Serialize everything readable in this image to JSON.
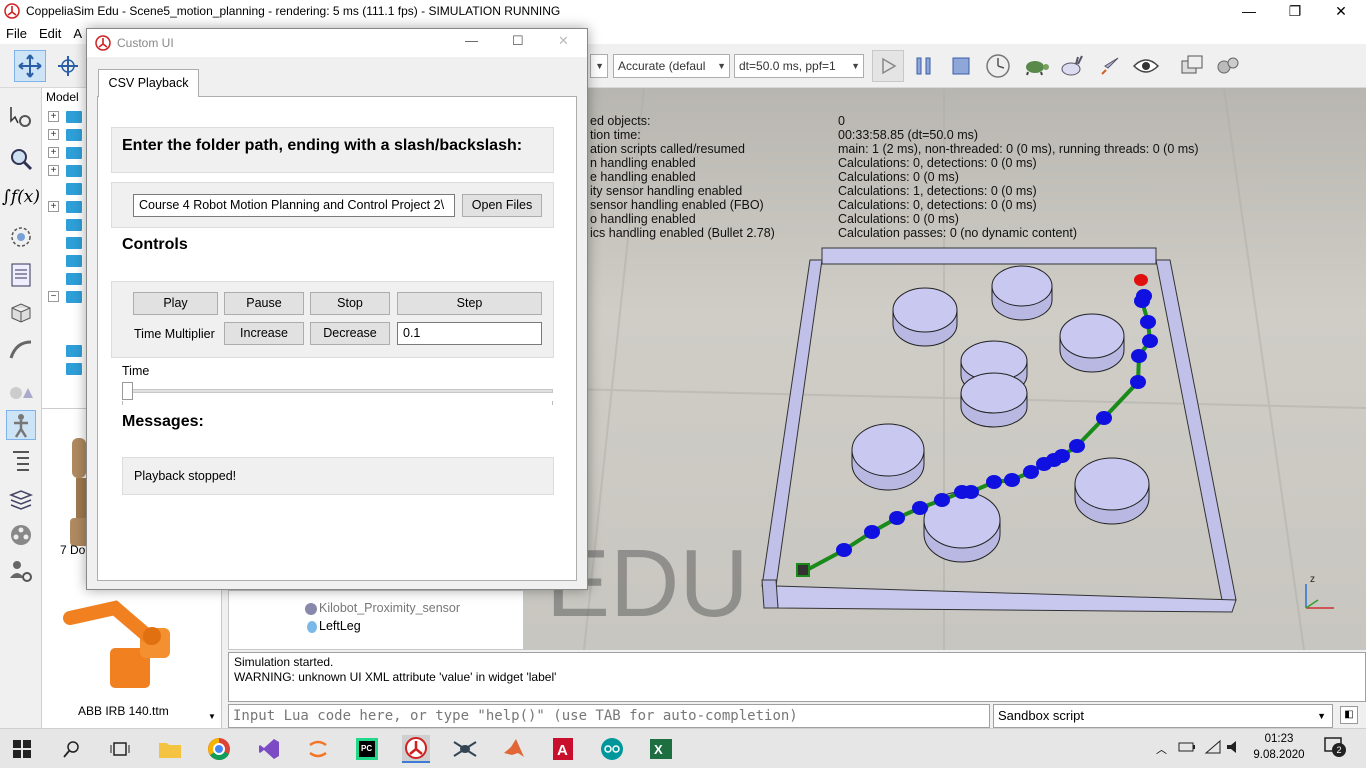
{
  "window": {
    "title": "CoppeliaSim Edu - Scene5_motion_planning - rendering: 5 ms (111.1 fps) - SIMULATION RUNNING"
  },
  "menu": {
    "items": [
      "File",
      "Edit",
      "A"
    ]
  },
  "toolbar": {
    "engine_combo": "Accurate (defaul",
    "dt_combo": "dt=50.0 ms, ppf=1"
  },
  "model_browser": {
    "header": "Model",
    "model_label_1": "7 Do",
    "model_label_2": "ABB IRB 140.ttm"
  },
  "scene_hierarchy": {
    "item_1": "Kilobot_Proximity_sensor",
    "item_2": "LeftLeg"
  },
  "viewport": {
    "info_left": [
      "ed objects:",
      "tion time:",
      "ation scripts called/resumed",
      "n handling enabled",
      "e handling enabled",
      "ity sensor handling enabled",
      "sensor handling enabled (FBO)",
      "o handling enabled",
      "ics handling enabled (Bullet 2.78)"
    ],
    "info_right": [
      "0",
      "00:33:58.85 (dt=50.0 ms)",
      "main: 1 (2 ms), non-threaded: 0 (0 ms), running threads: 0 (0 ms)",
      "Calculations: 0, detections: 0 (0 ms)",
      "Calculations: 0 (0 ms)",
      "Calculations: 1, detections: 0 (0 ms)",
      "Calculations: 0, detections: 0 (0 ms)",
      "Calculations: 0 (0 ms)",
      "Calculation passes: 0 (no dynamic content)"
    ],
    "watermark": "EDU",
    "axis_z": "z",
    "colors": {
      "path": "#1a8a1a",
      "waypoint": "#1010e0",
      "start": "#e01010",
      "obstacle": "#c8c8f0",
      "wall": "#c0c0e8"
    }
  },
  "console": {
    "lines": [
      "Simulation started.",
      "WARNING: unknown UI XML attribute 'value' in widget 'label'"
    ]
  },
  "lua_input": {
    "placeholder": "Input Lua code here, or type \"help()\" (use TAB for auto-completion)"
  },
  "script_select": {
    "value": "Sandbox script"
  },
  "dialog": {
    "title": "Custom UI",
    "tab": "CSV Playback",
    "folder_header": "Enter the folder path, ending with a slash/backslash:",
    "folder_value": "Course 4 Robot Motion Planning and Control Project 2\\",
    "open_files": "Open Files",
    "controls_header": "Controls",
    "play": "Play",
    "pause": "Pause",
    "stop": "Stop",
    "step": "Step",
    "time_multiplier_label": "Time Multiplier",
    "increase": "Increase",
    "decrease": "Decrease",
    "multiplier_value": "0.1",
    "time_label": "Time",
    "time_slider_value": 0,
    "messages_header": "Messages:",
    "message_text": "Playback stopped!"
  },
  "taskbar": {
    "time": "01:23",
    "date": "9.08.2020",
    "notif_count": "2"
  }
}
